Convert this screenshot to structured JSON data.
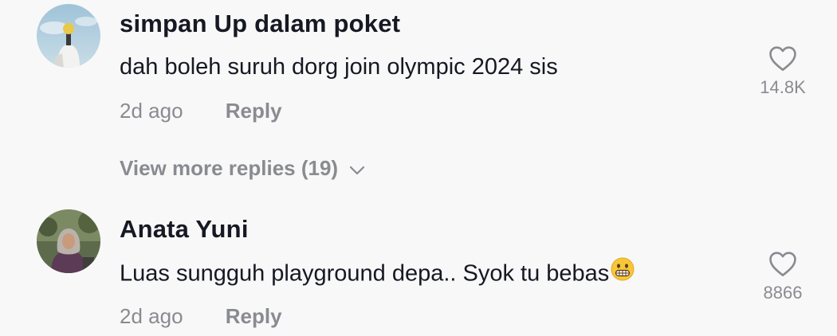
{
  "colors": {
    "background": "#f8f8f8",
    "primary_text": "#161823",
    "secondary_text": "#8a8b91"
  },
  "comments": [
    {
      "username": "simpan Up dalam poket",
      "text": "dah boleh suruh dorg join olympic 2024 sis",
      "time": "2d ago",
      "reply_label": "Reply",
      "likes": "14.8K",
      "like_icon": "heart-outline-icon",
      "view_more_replies": "View more replies (19)",
      "view_more_icon": "chevron-down-icon"
    },
    {
      "username": "Anata Yuni",
      "text": "Luas sungguh playground depa.. Syok tu bebas",
      "emoji": "grimacing-face-emoji",
      "time": "2d ago",
      "reply_label": "Reply",
      "likes": "8866",
      "like_icon": "heart-outline-icon"
    }
  ]
}
